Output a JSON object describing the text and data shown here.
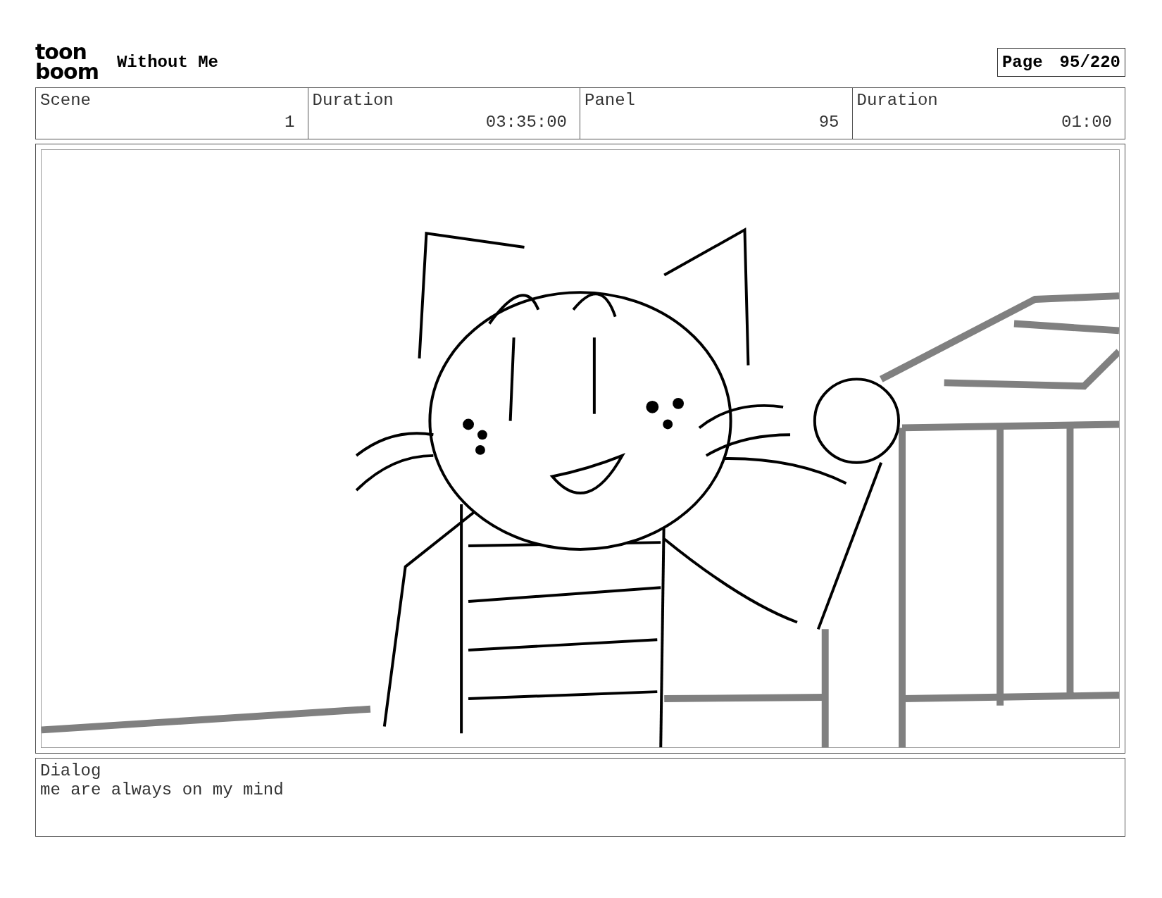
{
  "header": {
    "logo": [
      "toon",
      "boom"
    ],
    "title": "Without Me",
    "page_label": "Page",
    "page_value": "95/220"
  },
  "info": [
    {
      "label": "Scene",
      "value": "1"
    },
    {
      "label": "Duration",
      "value": "03:35:00"
    },
    {
      "label": "Panel",
      "value": "95"
    },
    {
      "label": "Duration",
      "value": "01:00"
    }
  ],
  "panel": {
    "kind": "drawing"
  },
  "dialog": {
    "label": "Dialog",
    "text": "me are always on my mind"
  }
}
